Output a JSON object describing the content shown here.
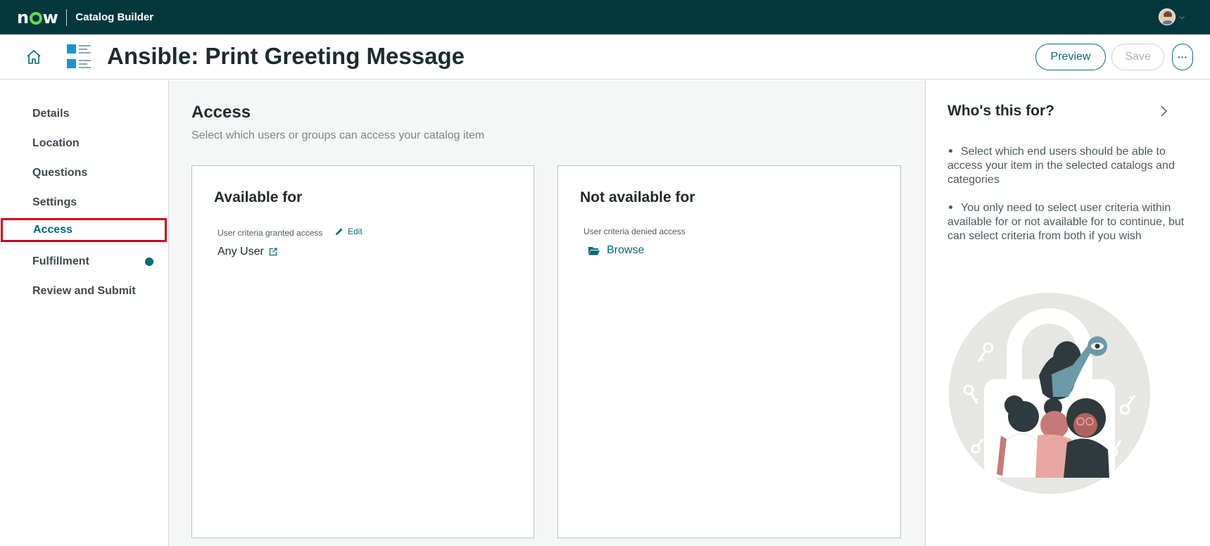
{
  "topbar": {
    "logo": "now",
    "app_name": "Catalog Builder"
  },
  "header": {
    "title": "Ansible: Print Greeting Message",
    "preview_label": "Preview",
    "save_label": "Save",
    "more_label": "···"
  },
  "sidenav": {
    "items": [
      {
        "label": "Details"
      },
      {
        "label": "Location"
      },
      {
        "label": "Questions"
      },
      {
        "label": "Settings"
      },
      {
        "label": "Access"
      },
      {
        "label": "Fulfillment"
      },
      {
        "label": "Review and Submit"
      }
    ],
    "active_index": 4
  },
  "main": {
    "title": "Access",
    "subtitle": "Select which users or groups can access your catalog item",
    "available": {
      "title": "Available for",
      "field_label": "User criteria granted access",
      "edit_label": "Edit",
      "value": "Any User"
    },
    "not_available": {
      "title": "Not available for",
      "field_label": "User criteria denied access",
      "browse_label": "Browse"
    }
  },
  "rightpanel": {
    "title": "Who's this for?",
    "bullets": [
      "Select which end users should be able to access your item in the selected catalogs and categories",
      "You only need to select user criteria within available for or not available for to continue, but can select criteria from both if you wish"
    ]
  },
  "colors": {
    "topbar": "#03373e",
    "accent": "#036a76",
    "logo_o": "#62d84e",
    "highlight_border": "#d0021b"
  }
}
